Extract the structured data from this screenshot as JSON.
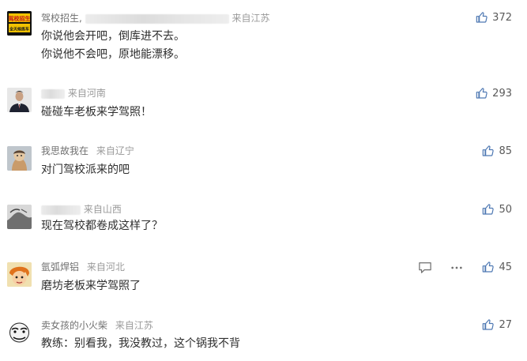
{
  "comments": [
    {
      "username": "驾校招生",
      "region": "来自江苏",
      "text": [
        "你说他会开吧，倒库进不去。",
        "你说他不会吧，原地能漂移。"
      ],
      "likes": "372",
      "avatar_badge_top": "驾校招生",
      "avatar_badge_bottom": "全天候练车"
    },
    {
      "username": "",
      "region": "来自河南",
      "text": [
        "碰碰车老板来学驾照！"
      ],
      "likes": "293"
    },
    {
      "username": "我思故我在",
      "region": "来自辽宁",
      "text": [
        "对门驾校派来的吧"
      ],
      "likes": "85"
    },
    {
      "username": "",
      "region": "来自山西",
      "text": [
        "现在驾校都卷成这样了？"
      ],
      "likes": "50"
    },
    {
      "username": "氩弧焊铝",
      "region": "来自河北",
      "text": [
        "磨坊老板来学驾照了"
      ],
      "likes": "45"
    },
    {
      "username": "卖女孩的小火柴",
      "region": "来自江苏",
      "text": [
        "教练：别看我，我没教过，这个锅我不背"
      ],
      "likes": "27"
    }
  ],
  "colors": {
    "text": "#2f2f2f",
    "meta": "#6f6f6f",
    "region": "#9a9a9a",
    "like_icon": "#4f79b3"
  },
  "icons": {
    "like": "thumbs-up-icon",
    "reply": "comment-icon",
    "more": "more-dots-icon"
  }
}
